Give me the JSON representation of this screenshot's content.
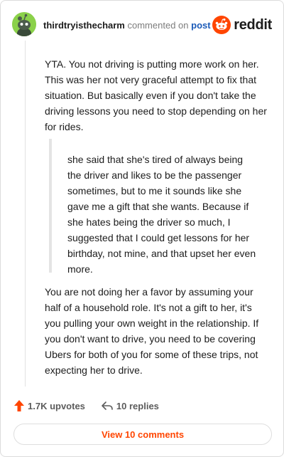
{
  "comment": {
    "username": "thirdtryisthecharm",
    "action_text": "commented on",
    "post_link": "post",
    "paragraph1": "YTA. You not driving is putting more work on her. This was her not very graceful attempt to fix that situation. But basically even if you don't take the driving lessons you need to stop depending on her for rides.",
    "quote": "she said that she's tired of always being the driver and likes to be the passenger sometimes, but to me it sounds like she gave me a gift that she wants. Because if she hates being the driver so much, I suggested that I could get lessons for her birthday, not mine, and that upset her even more.",
    "paragraph2": "You are not doing her a favor by assuming your half of a household role. It's not a gift to her, it's you pulling your own weight in the relationship. If you don't want to drive, you need to be covering Ubers for both of you for some of these trips, not expecting her to drive."
  },
  "brand": {
    "wordmark": "reddit",
    "accent": "#ff4500"
  },
  "actions": {
    "upvotes": "1.7K upvotes",
    "replies": "10 replies"
  },
  "view_comments_label": "View 10 comments",
  "icons": {
    "avatar": "avatar-icon",
    "logo": "reddit-logo-icon",
    "upvote": "upvote-arrow-icon",
    "reply": "reply-arrow-icon"
  }
}
